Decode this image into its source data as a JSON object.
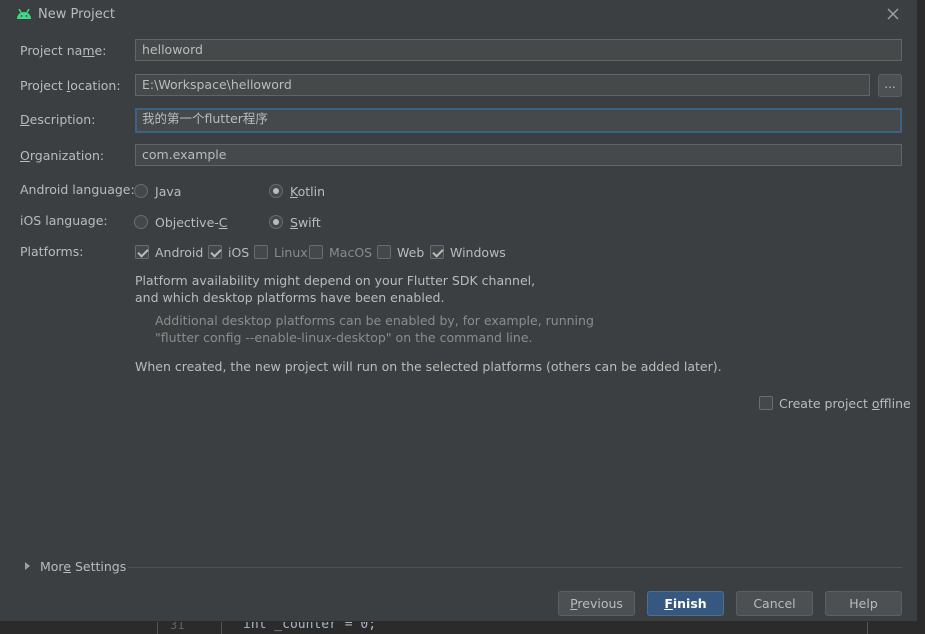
{
  "window": {
    "title": "New Project"
  },
  "fields": {
    "project_name": {
      "label_pre": "Project na",
      "label_mn": "m",
      "label_post": "e:",
      "value": "helloword"
    },
    "project_location": {
      "label_pre": "Project ",
      "label_mn": "l",
      "label_post": "ocation:",
      "value": "E:\\Workspace\\helloword",
      "browse_label": "..."
    },
    "description": {
      "label_pre": "",
      "label_mn": "D",
      "label_post": "escription:",
      "value": "我的第一个flutter程序"
    },
    "organization": {
      "label_pre": "",
      "label_mn": "O",
      "label_post": "rganization:",
      "value": "com.example"
    }
  },
  "android_language": {
    "label": "Android language:",
    "options": [
      {
        "mn": "J",
        "rest": "ava",
        "selected": false
      },
      {
        "mn": "K",
        "rest": "otlin",
        "selected": true
      }
    ]
  },
  "ios_language": {
    "label": "iOS language:",
    "options": [
      {
        "pre": "Objective-",
        "mn": "C",
        "selected": false
      },
      {
        "mn": "S",
        "rest": "wift",
        "selected": true
      }
    ]
  },
  "platforms": {
    "label": "Platforms:",
    "items": [
      {
        "name": "Android",
        "checked": true
      },
      {
        "name": "iOS",
        "checked": true
      },
      {
        "name": "Linux",
        "checked": false
      },
      {
        "name": "MacOS",
        "checked": false
      },
      {
        "name": "Web",
        "checked": false
      },
      {
        "name": "Windows",
        "checked": true
      }
    ]
  },
  "notes": {
    "availability_1": "Platform availability might depend on your Flutter SDK channel,",
    "availability_2": "and which desktop platforms have been enabled.",
    "hint_1": "Additional desktop platforms can be enabled by, for example, running",
    "hint_2": "\"flutter config --enable-linux-desktop\" on the command line.",
    "created": "When created, the new project will run on the selected platforms (others can be added later)."
  },
  "offline": {
    "pre": "Create project ",
    "mn": "o",
    "post": "ffline",
    "checked": false
  },
  "more_settings": {
    "pre": "Mor",
    "mn": "e",
    "post": " Settings"
  },
  "buttons": {
    "previous": {
      "mn": "P",
      "rest": "revious"
    },
    "finish": {
      "mn": "F",
      "rest": "inish"
    },
    "cancel": "Cancel",
    "help": "Help"
  },
  "background_editor": {
    "line_number": "31",
    "code": "int _counter = 0;"
  },
  "colors": {
    "dialog_bg": "#3c3f41",
    "input_bg": "#45494a",
    "focus_border": "#3d6185",
    "primary_button": "#365880",
    "android_icon": "#3ddc84"
  }
}
